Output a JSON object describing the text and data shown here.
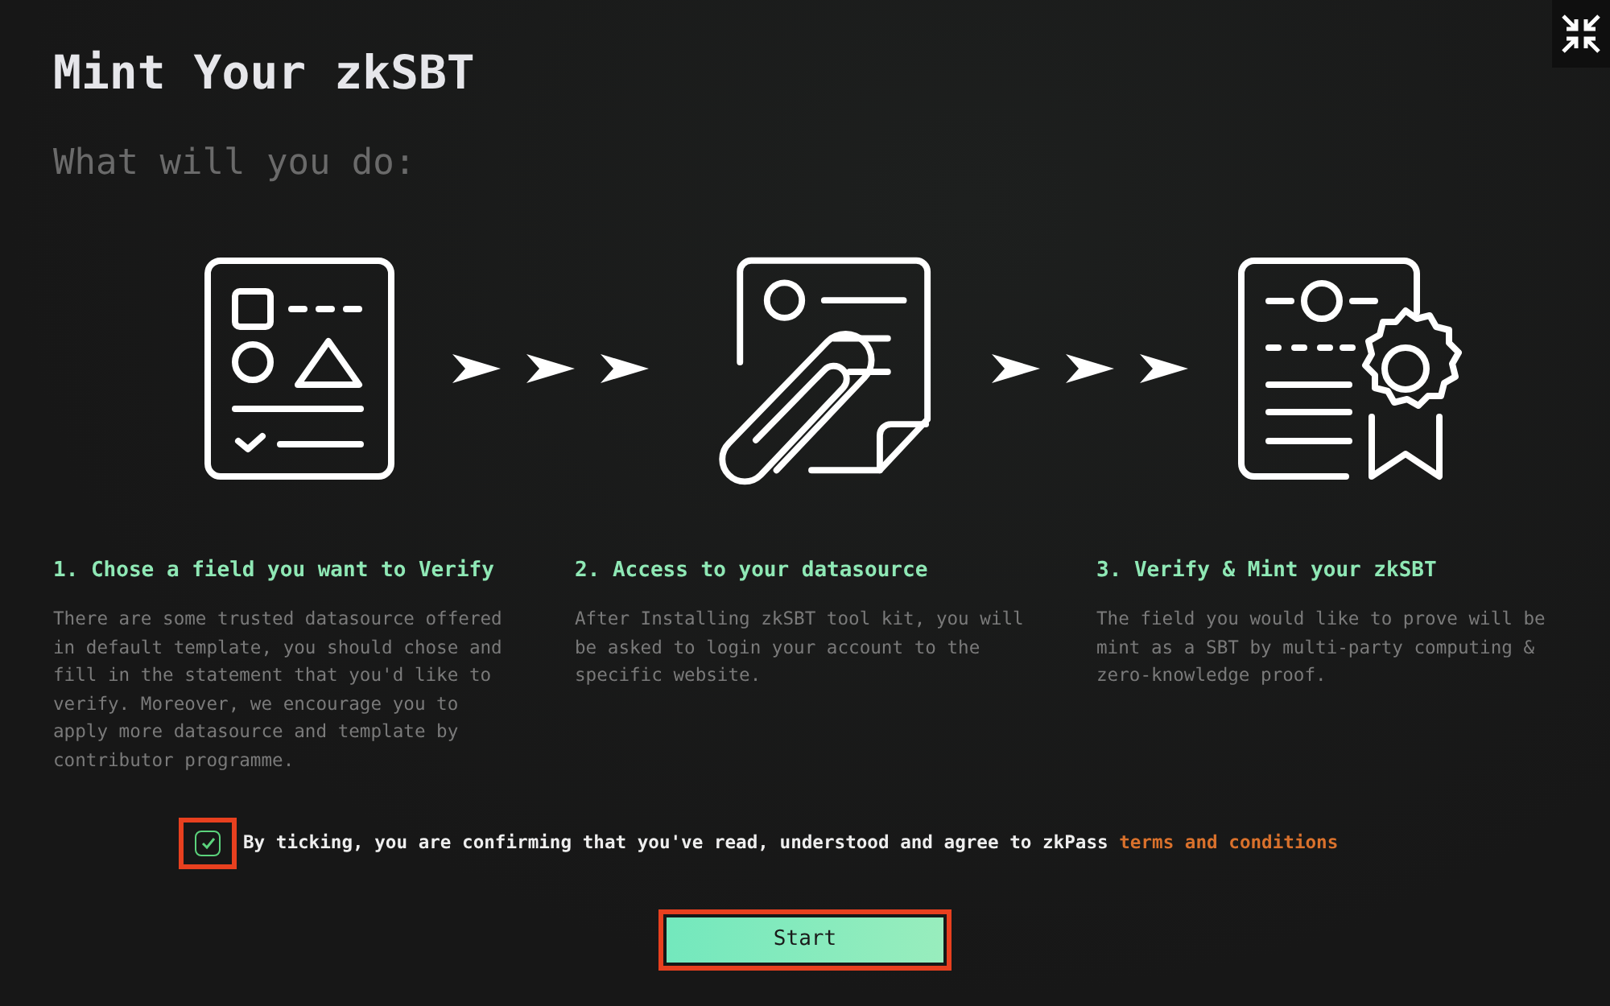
{
  "title": "Mint Your zkSBT",
  "subtitle": "What will you do:",
  "steps": [
    {
      "kind": "form",
      "title": "1. Chose a field you want to Verify",
      "description": "There are some trusted datasource offered in default template, you should chose and fill in the statement that you'd like to verify. Moreover, we encourage you to apply more datasource and template by contributor programme."
    },
    {
      "kind": "attach",
      "title": "2. Access to your datasource",
      "description": "After Installing zkSBT tool kit, you will be asked to login your account to the specific website."
    },
    {
      "kind": "certificate",
      "title": "3. Verify & Mint your zkSBT",
      "description": "The field you would like to prove will be mint as a SBT by multi-party computing & zero-knowledge proof."
    }
  ],
  "agreement": {
    "checked": true,
    "text": "By ticking, you are confirming that you've read, understood and agree to zkPass",
    "link": "terms and conditions"
  },
  "start_button": "Start"
}
